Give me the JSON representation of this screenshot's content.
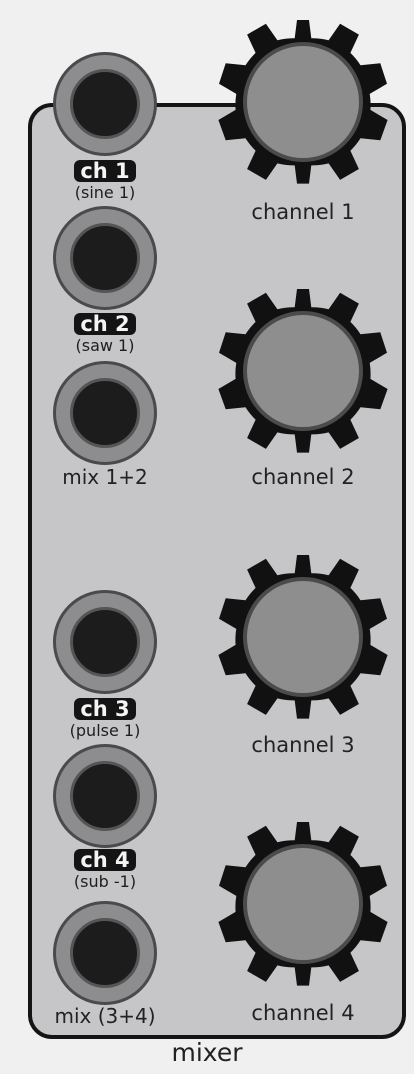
{
  "module": {
    "title": "mixer"
  },
  "inputs": [
    {
      "tag": "ch 1",
      "source": "(sine 1)"
    },
    {
      "tag": "ch 2",
      "source": "(saw 1)"
    },
    {
      "tag": "ch 3",
      "source": "(pulse 1)"
    },
    {
      "tag": "ch 4",
      "source": "(sub -1)"
    }
  ],
  "outputs": [
    {
      "label": "mix 1+2"
    },
    {
      "label": "mix (3+4)"
    }
  ],
  "knobs": [
    {
      "label": "channel 1"
    },
    {
      "label": "channel 2"
    },
    {
      "label": "channel 3"
    },
    {
      "label": "channel 4"
    }
  ],
  "colors": {
    "panel": "#c6c6c8",
    "panel_border": "#141414",
    "knob_cap": "#8e8e8e",
    "knob_body": "#111111",
    "jack_socket": "#1c1c1c"
  }
}
